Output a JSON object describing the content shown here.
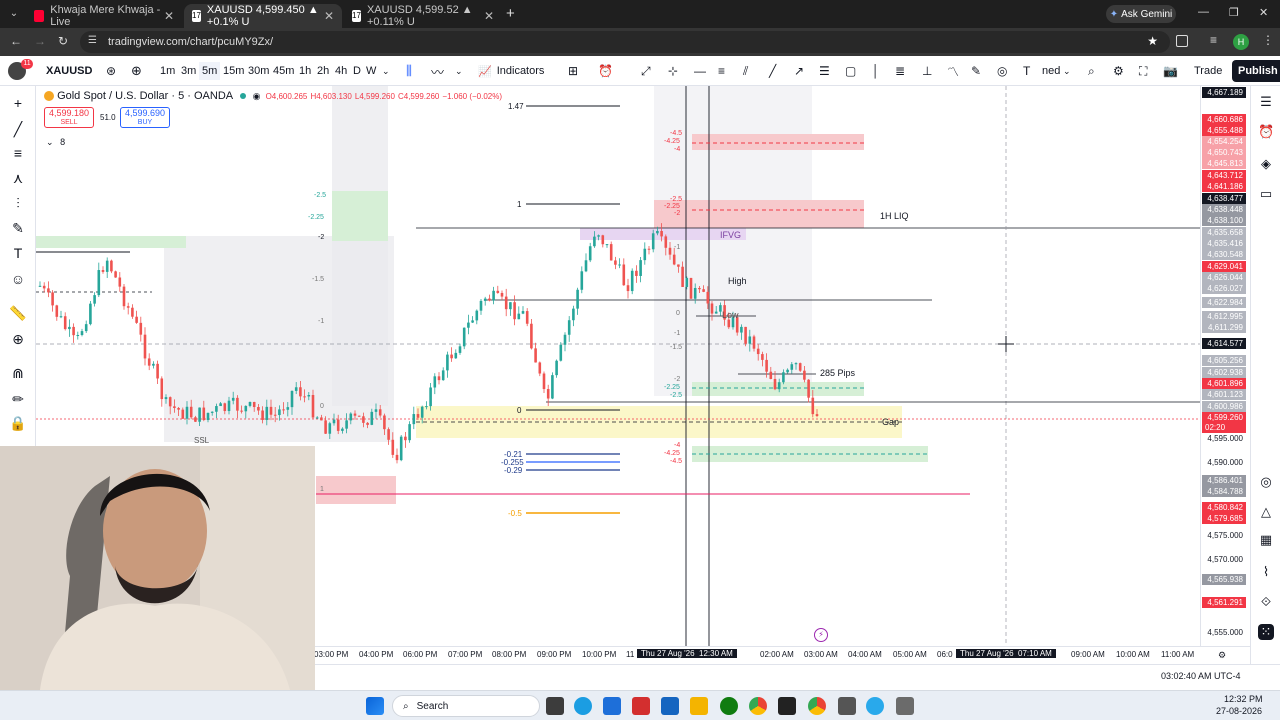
{
  "browser": {
    "tabs": [
      {
        "label": "Khwaja Mere Khwaja - Live",
        "icon": "youtube-icon"
      },
      {
        "label": "XAUUSD 4,599.450 ▲ +0.1% U",
        "icon": "tradingview-icon"
      },
      {
        "label": "XAUUSD 4,599.52 ▲ +0.11% U",
        "icon": "tradingview-icon"
      }
    ],
    "new_tab": "+",
    "ask_gemini": "Ask Gemini",
    "url": "tradingview.com/chart/pcuMY9Zx/",
    "profile_initial": "H",
    "notif_count": "11"
  },
  "toolbar": {
    "symbol": "XAUUSD",
    "intervals": [
      "1m",
      "3m",
      "5m",
      "15m",
      "30m",
      "45m",
      "1h",
      "2h",
      "4h",
      "D",
      "W"
    ],
    "active_interval": "5m",
    "indicators": "Indicators",
    "layout_name": "ned",
    "trade": "Trade",
    "publish": "Publish"
  },
  "legend": {
    "title": "Gold Spot / U.S. Dollar · 5 · OANDA",
    "o": "O4,600.265",
    "h": "H4,603.130",
    "l": "L4,599.260",
    "c": "C4,599.260",
    "chg": "−1.060 (−0.02%)",
    "sell_price": "4,599.180",
    "sell_label": "SELL",
    "spread": "51.0",
    "buy_price": "4,599.690",
    "buy_label": "BUY",
    "indicator_count": "8"
  },
  "annotations": {
    "ifvg": "IFVG",
    "liq": "1H LIQ",
    "high": "High",
    "low": "Low",
    "pips": "285 Pips",
    "gap": "Gap",
    "ssl": "SSL",
    "fib_levels_left": [
      "1.47",
      "1",
      "0",
      "-0.21",
      "-0.255",
      "-0.29",
      "-0.5"
    ],
    "fib_levels_green": [
      "-2.5",
      "-2.25",
      "-2",
      "-1.5",
      "-1",
      "0",
      "1"
    ],
    "fib_levels_mid": [
      "-4.5",
      "-4.25",
      "-4",
      "-2.5",
      "-2.25",
      "-2",
      "-1",
      "0",
      "-1",
      "-1.5",
      "-2",
      "-2.25",
      "-2.5",
      "-4",
      "-4.25",
      "-4.5"
    ]
  },
  "price_scale": {
    "top": "4,667.189",
    "labels_red": [
      "4,660.686",
      "4,655.488",
      "4,654.254",
      "4,650.743",
      "4,645.813",
      "4,643.712",
      "4,641.186"
    ],
    "label_black": "4,638.477",
    "labels_gray": [
      "4,638.448",
      "4,638.100",
      "4,635.658",
      "4,635.416",
      "4,630.548"
    ],
    "label_red2": "4,629.041",
    "labels_gray2": [
      "4,626.044",
      "4,626.027",
      "4,622.984",
      "4,612.995",
      "4,611.299"
    ],
    "crosshair": "4,614.577",
    "labels_gray3": [
      "4,605.256",
      "4,602.938"
    ],
    "label_red3": "4,601.896",
    "labels_gray4": [
      "4,601.123",
      "4,600.986"
    ],
    "current": "4,599.260",
    "countdown": "02:20",
    "plain": [
      "4,595.000",
      "4,590.000",
      "4,575.000",
      "4,570.000",
      "4,555.000"
    ],
    "labels_gray5": [
      "4,586.401",
      "4,584.788"
    ],
    "labels_red4": [
      "4,580.842",
      "4,579.685"
    ],
    "label_gray6": "4,565.938",
    "label_red5": "4,561.291"
  },
  "time_scale": {
    "labels": [
      "03:00 PM",
      "04:00 PM",
      "06:00 PM",
      "07:00 PM",
      "08:00 PM",
      "09:00 PM",
      "10:00 PM",
      "11",
      "02:00 AM",
      "03:00 AM",
      "04:00 AM",
      "05:00 AM",
      "06:0",
      "09:00 AM",
      "10:00 AM",
      "11:00 AM"
    ],
    "cursor1": "Thu 27 Aug '26  12:30 AM",
    "cursor2": "Thu 27 Aug '26  07:10 AM"
  },
  "status": {
    "clock": "03:02:40 AM UTC-4"
  },
  "taskbar": {
    "search": "Search",
    "time": "12:32 PM",
    "date": "27-08-2026"
  },
  "colors": {
    "bull": "#26a69a",
    "bear": "#ef5350",
    "accent_red": "#f23645",
    "accent_blue": "#2962ff"
  }
}
